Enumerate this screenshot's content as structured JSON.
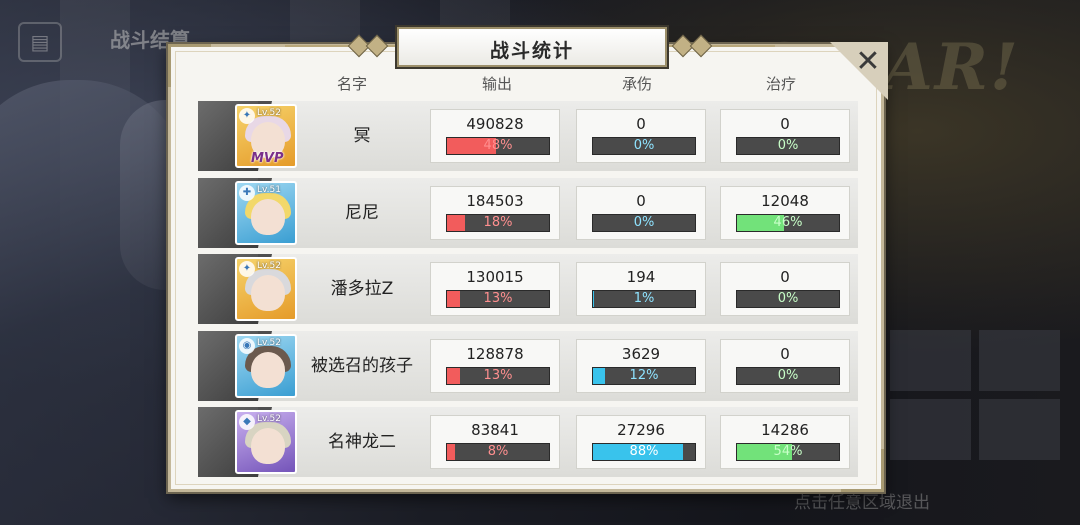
{
  "background": {
    "title": "战斗结算",
    "exit_hint": "点击任意区域退出",
    "banner_text": "GE AR!"
  },
  "dialog": {
    "title": "战斗统计",
    "close_label": "✕",
    "headers": {
      "name": "名字",
      "damage": "输出",
      "tank": "承伤",
      "heal": "治疗"
    }
  },
  "rows": [
    {
      "name": "冥",
      "level": "Lv.52",
      "frame": "gold",
      "mvp": "MVP",
      "damage": "490828",
      "damage_pct": "48%",
      "damage_frac": 0.48,
      "tank": "0",
      "tank_pct": "0%",
      "tank_frac": 0.0,
      "heal": "0",
      "heal_pct": "0%",
      "heal_frac": 0.0
    },
    {
      "name": "尼尼",
      "level": "Lv.51",
      "frame": "blue",
      "mvp": "",
      "damage": "184503",
      "damage_pct": "18%",
      "damage_frac": 0.18,
      "tank": "0",
      "tank_pct": "0%",
      "tank_frac": 0.0,
      "heal": "12048",
      "heal_pct": "46%",
      "heal_frac": 0.46
    },
    {
      "name": "潘多拉Z",
      "level": "Lv.52",
      "frame": "gold",
      "mvp": "",
      "damage": "130015",
      "damage_pct": "13%",
      "damage_frac": 0.13,
      "tank": "194",
      "tank_pct": "1%",
      "tank_frac": 0.01,
      "heal": "0",
      "heal_pct": "0%",
      "heal_frac": 0.0
    },
    {
      "name": "被选召的孩子",
      "level": "Lv.52",
      "frame": "blue",
      "mvp": "",
      "damage": "128878",
      "damage_pct": "13%",
      "damage_frac": 0.13,
      "tank": "3629",
      "tank_pct": "12%",
      "tank_frac": 0.12,
      "heal": "0",
      "heal_pct": "0%",
      "heal_frac": 0.0
    },
    {
      "name": "名神龙二",
      "level": "Lv.52",
      "frame": "purple",
      "mvp": "",
      "damage": "83841",
      "damage_pct": "8%",
      "damage_frac": 0.08,
      "tank": "27296",
      "tank_pct": "88%",
      "tank_frac": 0.88,
      "heal": "14286",
      "heal_pct": "54%",
      "heal_frac": 0.54
    }
  ],
  "colors": {
    "damage": "#f25c5c",
    "tank": "#39c3ec",
    "heal": "#72e27a"
  }
}
